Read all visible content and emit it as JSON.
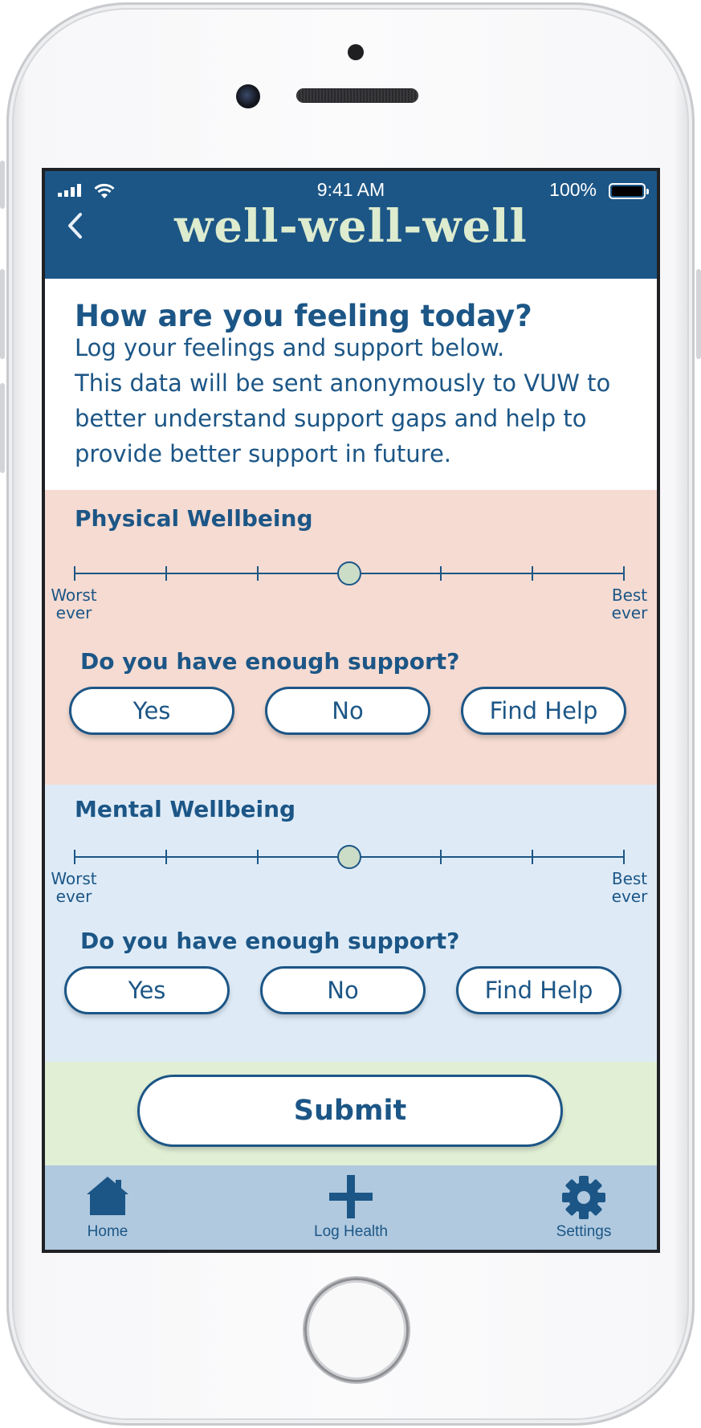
{
  "status": {
    "time": "9:41 AM",
    "battery": "100%"
  },
  "header": {
    "back_icon": "chevron-left-icon",
    "title": "well-well-well"
  },
  "intro": {
    "heading": "How are you feeling today?",
    "lines": [
      "Log your feelings and support below.",
      "This data will be sent anonymously to VUW to",
      "better understand support gaps and help to",
      "provide better support in future."
    ]
  },
  "physical": {
    "title": "Physical Wellbeing",
    "scale_steps": 7,
    "selected_step": 4,
    "min_label": [
      "Worst",
      "ever"
    ],
    "max_label": [
      "Best",
      "ever"
    ],
    "question": "Do you have enough support?",
    "buttons": [
      "Yes",
      "No",
      "Find Help"
    ]
  },
  "mental": {
    "title": "Mental Wellbeing",
    "scale_steps": 7,
    "selected_step": 4,
    "min_label": [
      "Worst",
      "ever"
    ],
    "max_label": [
      "Best",
      "ever"
    ],
    "question": "Do you have enough support?",
    "buttons": [
      "Yes",
      "No",
      "Find Help"
    ]
  },
  "submit_label": "Submit",
  "tabs": [
    {
      "label": "Home",
      "icon": "home-icon"
    },
    {
      "label": "Log Health",
      "icon": "plus-icon"
    },
    {
      "label": "Settings",
      "icon": "gear-icon"
    }
  ],
  "colors": {
    "primary": "#1c5686",
    "title_text": "#ddebce",
    "physical_bg": "#f5dbd2",
    "mental_bg": "#deebf7",
    "submit_bg": "#e1efd5",
    "tabbar_bg": "#b0c9df",
    "thumb": "#cbdcc7"
  }
}
